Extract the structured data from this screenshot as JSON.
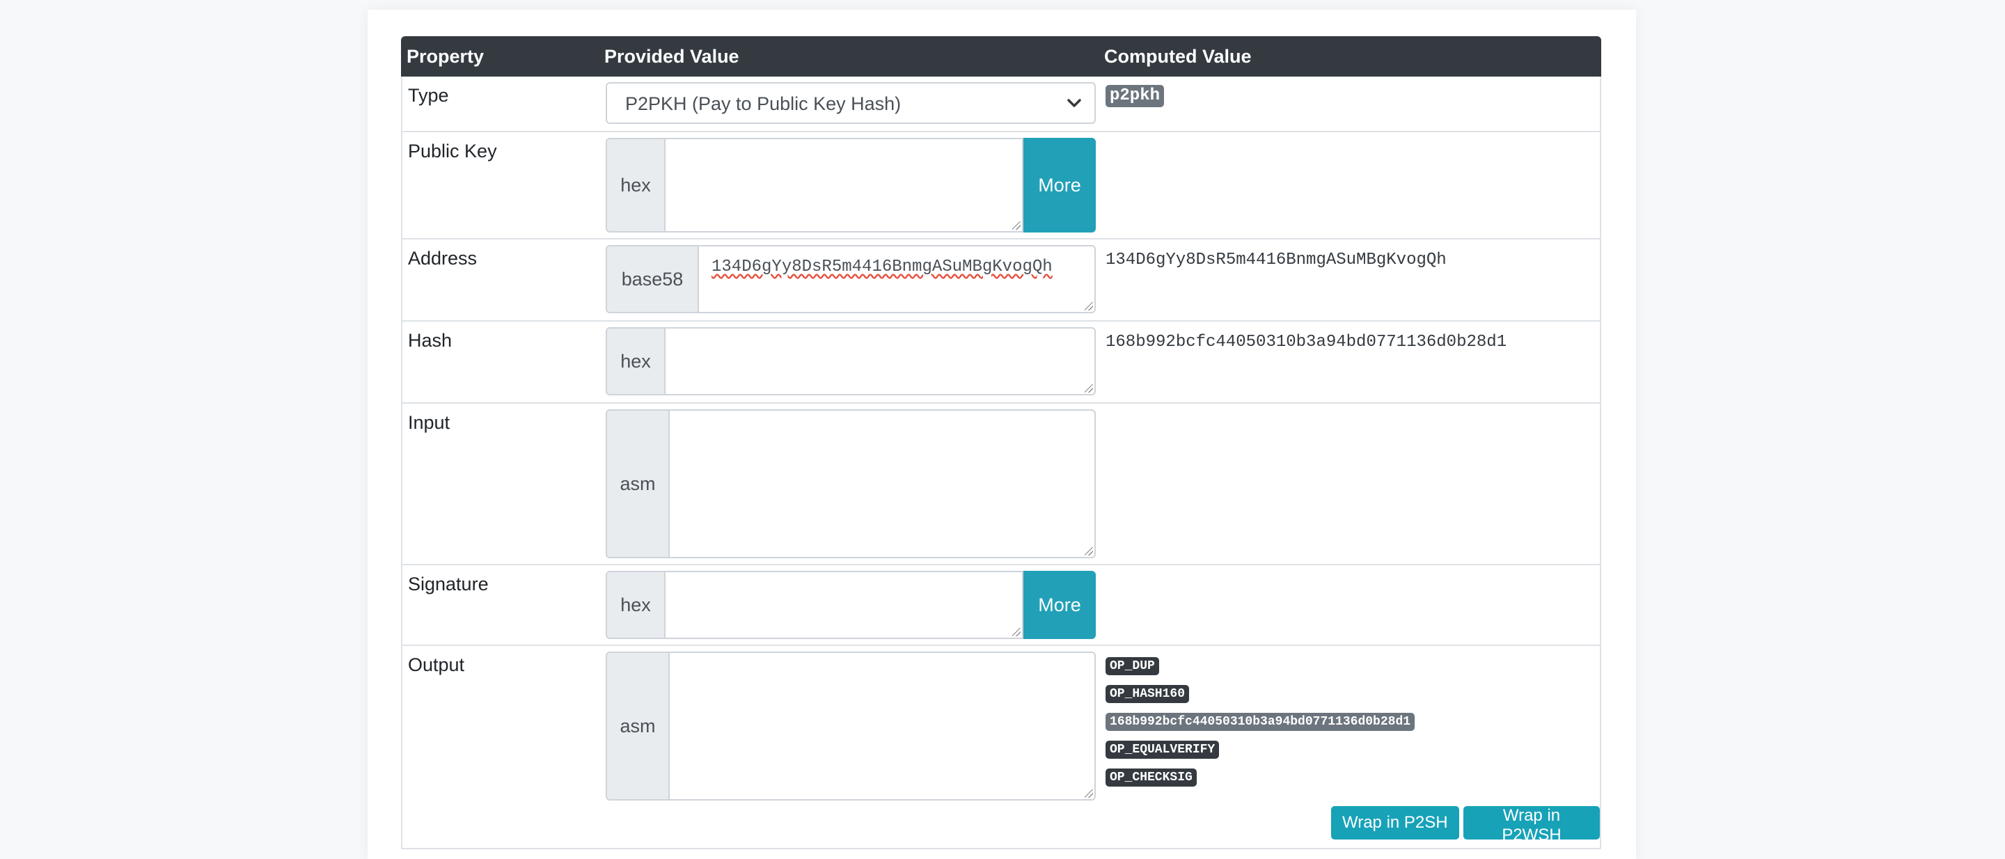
{
  "table": {
    "headers": [
      "Property",
      "Provided Value",
      "Computed Value"
    ]
  },
  "rows": {
    "type": {
      "label": "Type",
      "selected": "P2PKH (Pay to Public Key Hash)",
      "computed_badge": "p2pkh"
    },
    "public_key": {
      "label": "Public Key",
      "addon": "hex",
      "value": "",
      "button": "More"
    },
    "address": {
      "label": "Address",
      "addon": "base58",
      "value": "134D6gYy8DsR5m4416BnmgASuMBgKvogQh",
      "computed": "134D6gYy8DsR5m4416BnmgASuMBgKvogQh"
    },
    "hash": {
      "label": "Hash",
      "addon": "hex",
      "value": "",
      "computed": "168b992bcfc44050310b3a94bd0771136d0b28d1"
    },
    "input": {
      "label": "Input",
      "addon": "asm",
      "value": ""
    },
    "signature": {
      "label": "Signature",
      "addon": "hex",
      "value": "",
      "button": "More"
    },
    "output": {
      "label": "Output",
      "addon": "asm",
      "value": "",
      "ops": [
        "OP_DUP",
        "OP_HASH160",
        "168b992bcfc44050310b3a94bd0771136d0b28d1",
        "OP_EQUALVERIFY",
        "OP_CHECKSIG"
      ],
      "wrap_p2sh": "Wrap in P2SH",
      "wrap_p2wsh": "Wrap in P2WSH"
    }
  },
  "colors": {
    "header_bg": "#343a40",
    "accent": "#17a2b8",
    "badge_dark": "#343a40",
    "badge_grey": "#6c757d"
  }
}
